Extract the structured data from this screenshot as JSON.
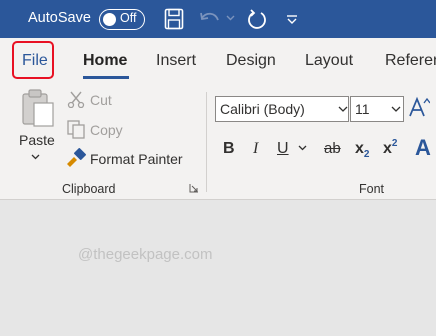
{
  "titlebar": {
    "autosave_label": "AutoSave",
    "autosave_toggle": "Off"
  },
  "tabs": {
    "file": "File",
    "home": "Home",
    "insert": "Insert",
    "design": "Design",
    "layout": "Layout",
    "references": "Referen"
  },
  "clipboard": {
    "paste": "Paste",
    "cut": "Cut",
    "copy": "Copy",
    "format_painter": "Format Painter",
    "group_label": "Clipboard"
  },
  "font": {
    "family": "Calibri (Body)",
    "size": "11",
    "bold": "B",
    "italic": "I",
    "underline": "U",
    "strikethrough": "ab",
    "subscript_base": "x",
    "subscript_mark": "2",
    "superscript_base": "x",
    "superscript_mark": "2",
    "effects": "A",
    "group_label": "Font"
  },
  "document": {
    "watermark": "@thegeekpage.com"
  },
  "colors": {
    "accent": "#2b579a",
    "highlight_box": "#e81123",
    "ribbon_bg": "#f3f2f1",
    "document_bg": "#e6e6e6"
  }
}
